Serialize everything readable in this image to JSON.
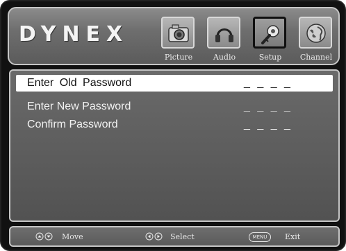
{
  "header": {
    "brand": "DYNEX",
    "tabs": [
      {
        "label": "Picture",
        "icon": "picture-icon",
        "active": false
      },
      {
        "label": "Audio",
        "icon": "audio-icon",
        "active": false
      },
      {
        "label": "Setup",
        "icon": "setup-icon",
        "active": true
      },
      {
        "label": "Channel",
        "icon": "channel-icon",
        "active": false
      }
    ]
  },
  "password_menu": {
    "rows": [
      {
        "label": "Enter  Old  Password",
        "value": "_ _ _ _",
        "selected": true
      },
      {
        "label": "Enter New Password",
        "value": "_ _ _ _",
        "selected": false
      },
      {
        "label": "Confirm Password",
        "value": "_ _ _ _",
        "selected": false
      }
    ]
  },
  "footer": {
    "move_label": "Move",
    "select_label": "Select",
    "menu_key": "MENU",
    "exit_label": "Exit"
  },
  "colors": {
    "panel_gray": "#5d5d5d",
    "highlight": "#ffffff",
    "frame_border": "#c6c6c6",
    "active_tab_border": "#101010"
  }
}
